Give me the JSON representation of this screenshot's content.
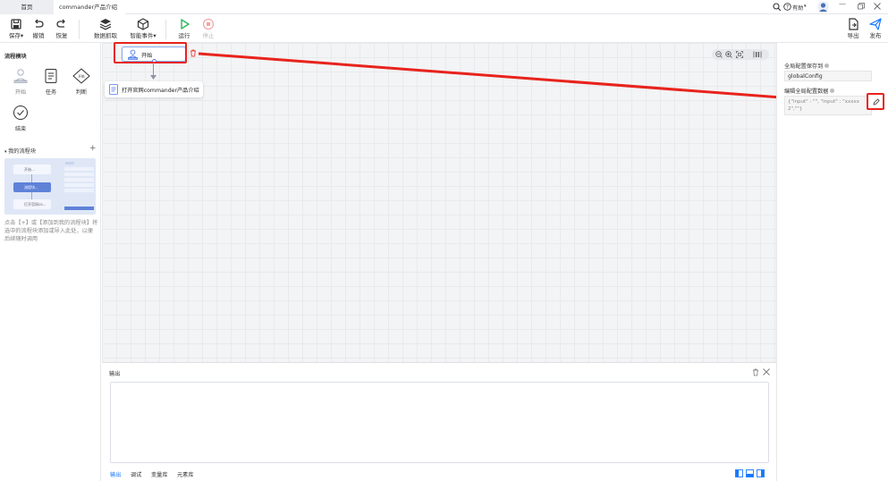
{
  "tabs": [
    {
      "label": "首页"
    },
    {
      "label": "commander产品介绍"
    }
  ],
  "window": {
    "help": "有助",
    "help_caret": "▾"
  },
  "toolbar": {
    "save": "保存",
    "undo": "撤销",
    "redo": "恢复",
    "data_capture": "数据抓取",
    "smart_event": "智能事件",
    "run": "运行",
    "stop": "停止",
    "export": "导出",
    "publish": "发布"
  },
  "left": {
    "section_title": "流程模块",
    "modules": [
      {
        "label": "开始"
      },
      {
        "label": "任务"
      },
      {
        "label": "判断"
      },
      {
        "label": "结束"
      }
    ],
    "decision_badge": "开始",
    "my_blocks_title": "我的流程块",
    "thumb": {
      "start": "开始...",
      "mid": "流程块...",
      "open": "打开官网co..."
    },
    "hint": "点击【+】或【添加到我的流程块】将选中的流程块添加或导入此处，以便后续随时调用"
  },
  "canvas": {
    "start_label": "开始",
    "task_label": "打开官网commander产品介绍"
  },
  "output": {
    "title": "输出",
    "tabs": [
      {
        "label": "输出"
      },
      {
        "label": "调试"
      },
      {
        "label": "变量库"
      },
      {
        "label": "元素库"
      }
    ]
  },
  "right": {
    "save_label": "全局配置保存到",
    "save_value": "globalConfig",
    "data_label": "编辑全局配置数据",
    "data_value": "{\"input\" : \"\", \"input\" : \"xxxxx 2\",\"\"}"
  },
  "colors": {
    "accent": "#1677ff",
    "run": "#2db55d",
    "stop": "#f5a3a3",
    "annotation": "#e8231c"
  }
}
